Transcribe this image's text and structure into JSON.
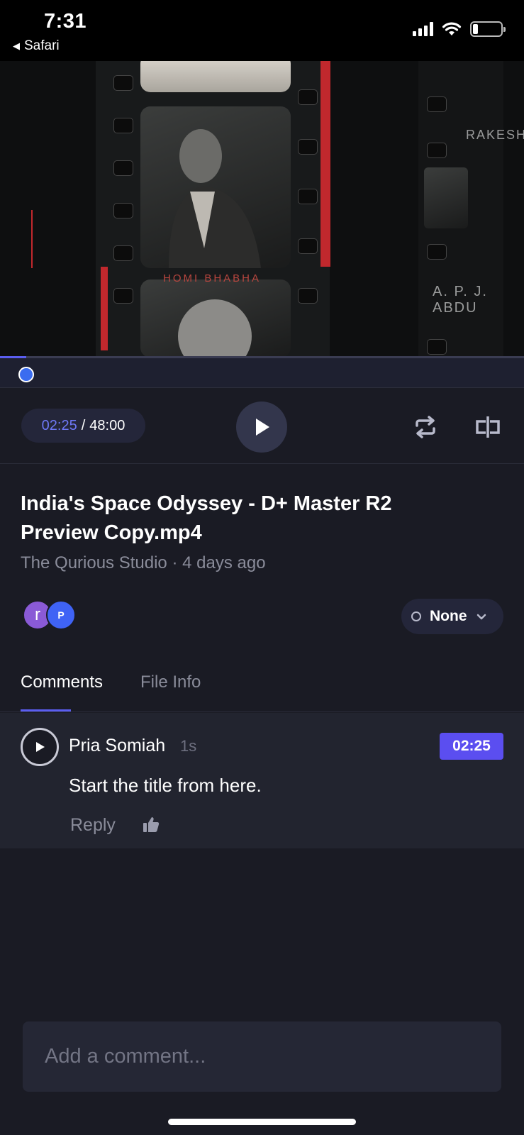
{
  "status_bar": {
    "time": "7:31",
    "back_app": "Safari",
    "back_icon": "back-triangle-icon",
    "signal_icon": "cellular-signal-icon",
    "wifi_icon": "wifi-icon",
    "battery_icon": "battery-icon",
    "battery_level": 0.15
  },
  "video": {
    "caption_left": "HOMI BHABHA",
    "caption_right_top": "RAKESH",
    "caption_right_bottom": "A. P. J. ABDU",
    "playback_progress": 0.05
  },
  "player": {
    "current_time": "02:25",
    "separator": "/",
    "duration": "48:00",
    "play_icon": "play-icon",
    "loop_icon": "loop-icon",
    "compare_icon": "compare-icon"
  },
  "file": {
    "title": "India's Space Odyssey - D+ Master R2 Preview Copy.mp4",
    "owner": "The Qurious Studio",
    "dot": "·",
    "age": "4 days ago"
  },
  "collaborators": [
    {
      "initial": "r",
      "color": "#8a5ad6"
    },
    {
      "initial": "P",
      "color": "#3f63f5"
    }
  ],
  "status_dropdown": {
    "value": "None",
    "chevron_icon": "chevron-down-icon"
  },
  "tabs": {
    "comments": "Comments",
    "file_info": "File Info"
  },
  "comment": {
    "author": "Pria Somiah",
    "time_ago": "1s",
    "timestamp": "02:25",
    "text": "Start the title from here.",
    "reply": "Reply",
    "like_icon": "thumbs-up-icon"
  },
  "comment_input": {
    "placeholder": "Add a comment..."
  },
  "colors": {
    "accent": "#5b5ef0",
    "background": "#1a1b24"
  }
}
